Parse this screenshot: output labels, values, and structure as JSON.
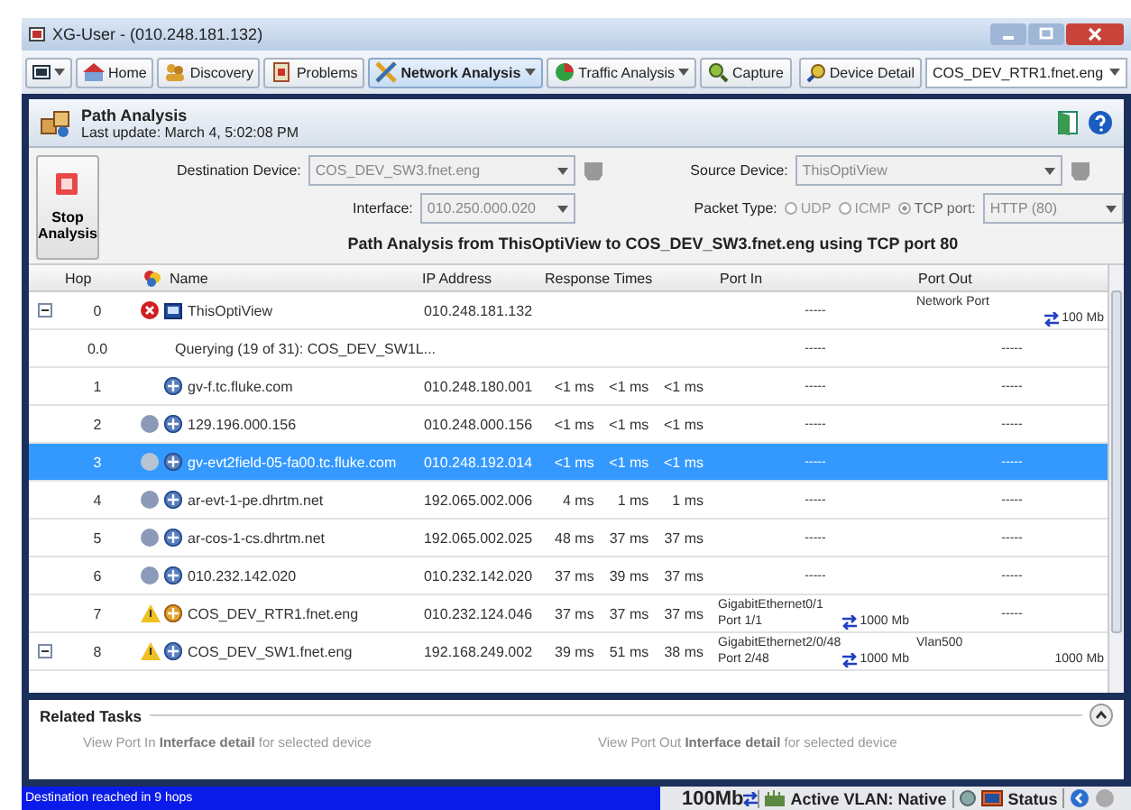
{
  "window": {
    "title": "XG-User - (010.248.181.132)"
  },
  "toolbar": {
    "buttons": [
      {
        "label": "Home",
        "selected": false,
        "caret": false
      },
      {
        "label": "Discovery",
        "selected": false,
        "caret": false
      },
      {
        "label": "Problems",
        "selected": false,
        "caret": false
      },
      {
        "label": "Network Analysis",
        "selected": true,
        "caret": true
      },
      {
        "label": "Traffic Analysis",
        "selected": false,
        "caret": true
      },
      {
        "label": "Capture",
        "selected": false,
        "caret": false
      }
    ],
    "device_detail": "Device Detail",
    "device_value": "COS_DEV_RTR1.fnet.eng"
  },
  "panel": {
    "title": "Path Analysis",
    "subtitle": "Last update: March 4, 5:02:08 PM"
  },
  "controls": {
    "stop_label": "Stop Analysis",
    "destination_label": "Destination Device:",
    "destination": "COS_DEV_SW3.fnet.eng",
    "interface_label": "Interface:",
    "interface": "010.250.000.020",
    "source_label": "Source Device:",
    "source": "ThisOptiView",
    "packet_label": "Packet Type:",
    "packet_types": [
      {
        "label": "UDP",
        "selected": false
      },
      {
        "label": "ICMP",
        "selected": false
      },
      {
        "label": "TCP port:",
        "selected": true
      }
    ],
    "port": "HTTP (80)",
    "heading": "Path Analysis from ThisOptiView to COS_DEV_SW3.fnet.eng using TCP port 80"
  },
  "table": {
    "columns": [
      "Hop",
      "Name",
      "IP Address",
      "Response Times",
      "Port In",
      "Port Out"
    ],
    "rows": [
      {
        "hop": "0",
        "expander": true,
        "kind": "source",
        "name": "ThisOptiView",
        "ip": "010.248.181.132",
        "times": [],
        "port_in": [
          "-----"
        ],
        "port_in_speed": "",
        "port_out": [
          "Network Port"
        ],
        "port_out_speed": "100 Mb",
        "selected": false
      },
      {
        "hop": "0.0",
        "expander": false,
        "kind": "query",
        "name": "Querying (19 of 31): COS_DEV_SW1L...",
        "ip": "",
        "times": [],
        "port_in": [
          "-----"
        ],
        "port_in_speed": "",
        "port_out": [
          "-----"
        ],
        "port_out_speed": "",
        "selected": false
      },
      {
        "hop": "1",
        "expander": false,
        "kind": "hop",
        "name": "gv-f.tc.fluke.com",
        "ip": "010.248.180.001",
        "times": [
          "<1 ms",
          "<1 ms",
          "<1 ms"
        ],
        "port_in": [
          "-----"
        ],
        "port_in_speed": "",
        "port_out": [
          "-----"
        ],
        "port_out_speed": "",
        "selected": false
      },
      {
        "hop": "2",
        "expander": false,
        "kind": "polled",
        "name": "129.196.000.156",
        "ip": "010.248.000.156",
        "times": [
          "<1 ms",
          "<1 ms",
          "<1 ms"
        ],
        "port_in": [
          "-----"
        ],
        "port_in_speed": "",
        "port_out": [
          "-----"
        ],
        "port_out_speed": "",
        "selected": false
      },
      {
        "hop": "3",
        "expander": false,
        "kind": "polled",
        "name": "gv-evt2field-05-fa00.tc.fluke.com",
        "ip": "010.248.192.014",
        "times": [
          "<1 ms",
          "<1 ms",
          "<1 ms"
        ],
        "port_in": [
          "-----"
        ],
        "port_in_speed": "",
        "port_out": [
          "-----"
        ],
        "port_out_speed": "",
        "selected": true
      },
      {
        "hop": "4",
        "expander": false,
        "kind": "polled",
        "name": "ar-evt-1-pe.dhrtm.net",
        "ip": "192.065.002.006",
        "times": [
          "4 ms",
          "1 ms",
          "1 ms"
        ],
        "port_in": [
          "-----"
        ],
        "port_in_speed": "",
        "port_out": [
          "-----"
        ],
        "port_out_speed": "",
        "selected": false
      },
      {
        "hop": "5",
        "expander": false,
        "kind": "polled",
        "name": "ar-cos-1-cs.dhrtm.net",
        "ip": "192.065.002.025",
        "times": [
          "48 ms",
          "37 ms",
          "37 ms"
        ],
        "port_in": [
          "-----"
        ],
        "port_in_speed": "",
        "port_out": [
          "-----"
        ],
        "port_out_speed": "",
        "selected": false
      },
      {
        "hop": "6",
        "expander": false,
        "kind": "polled",
        "name": "010.232.142.020",
        "ip": "010.232.142.020",
        "times": [
          "37 ms",
          "39 ms",
          "37 ms"
        ],
        "port_in": [
          "-----"
        ],
        "port_in_speed": "",
        "port_out": [
          "-----"
        ],
        "port_out_speed": "",
        "selected": false
      },
      {
        "hop": "7",
        "expander": false,
        "kind": "router",
        "name": "COS_DEV_RTR1.fnet.eng",
        "ip": "010.232.124.046",
        "times": [
          "37 ms",
          "37 ms",
          "37 ms"
        ],
        "port_in": [
          "GigabitEthernet0/1",
          "Port 1/1"
        ],
        "port_in_speed": "1000 Mb",
        "port_out": [
          "-----"
        ],
        "port_out_speed": "",
        "selected": false
      },
      {
        "hop": "8",
        "expander": true,
        "kind": "switch",
        "name": "COS_DEV_SW1.fnet.eng",
        "ip": "192.168.249.002",
        "times": [
          "39 ms",
          "51 ms",
          "38 ms"
        ],
        "port_in": [
          "GigabitEthernet2/0/48",
          "Port 2/48"
        ],
        "port_in_speed": "1000 Mb",
        "port_out": [
          "Vlan500"
        ],
        "port_out_speed": "1000 Mb",
        "selected": false
      }
    ]
  },
  "related_tasks": {
    "title": "Related Tasks",
    "items": [
      "View Port In **Interface detail** for selected device",
      "View Port Out **Interface detail** for selected device"
    ]
  },
  "status_bar": {
    "message": "Destination reached in 9 hops",
    "speed": "100Mb",
    "vlan": "Active VLAN: Native",
    "status": "Status"
  }
}
